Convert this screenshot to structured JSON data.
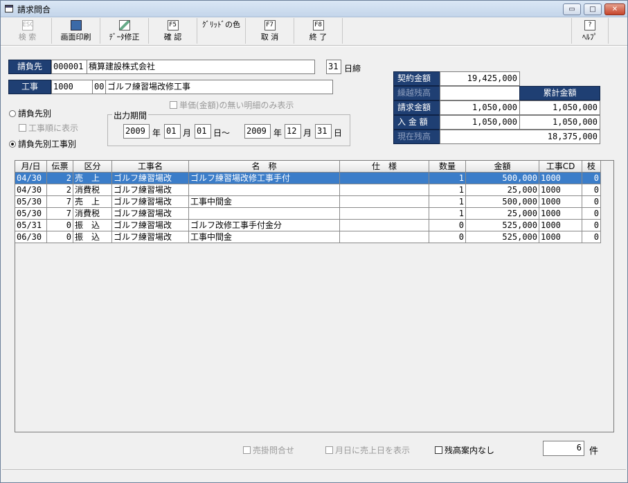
{
  "window": {
    "title": "請求問合"
  },
  "toolbar": {
    "search": {
      "key": "ESC",
      "label": "検 索"
    },
    "print": {
      "label": "画面印刷"
    },
    "edit": {
      "label": "ﾃﾞｰﾀ修正"
    },
    "confirm": {
      "key": "F5",
      "label": "確 認"
    },
    "gridcolor": {
      "label": "ｸﾞﾘｯﾄﾞの色"
    },
    "cancel": {
      "key": "F7",
      "label": "取 消"
    },
    "exit": {
      "key": "F8",
      "label": "終 了"
    },
    "help": {
      "key": "?",
      "label": "ﾍﾙﾌﾟ"
    }
  },
  "header": {
    "client_label": "請負先",
    "client_code": "000001",
    "client_name": "積算建設株式会社",
    "closing_day": "31",
    "closing_suffix": "日締",
    "project_label": "工事",
    "project_code": "1000",
    "project_branch": "00",
    "project_name": "ゴルフ練習場改修工事",
    "unit_price_option": "単価(金額)の無い明細のみ表示"
  },
  "options": {
    "by_client": "請負先別",
    "project_order": "工事順に表示",
    "by_client_project": "請負先別工事別"
  },
  "period": {
    "title": "出力期間",
    "from_year": "2009",
    "from_month": "01",
    "from_day": "01",
    "to_year": "2009",
    "to_month": "12",
    "to_day": "31",
    "year_unit": "年",
    "month_unit": "月",
    "day_unit": "日",
    "day_range": "日～"
  },
  "summary": {
    "contract_label": "契約金額",
    "contract_value": "19,425,000",
    "carryover_label": "繰越残高",
    "cumulative_label": "累計金額",
    "billing_label": "請求金額",
    "billing_value": "1,050,000",
    "billing_cumulative": "1,050,000",
    "payment_label": "入 金 額",
    "payment_value": "1,050,000",
    "payment_cumulative": "1,050,000",
    "balance_label": "現在残高",
    "balance_value": "18,375,000"
  },
  "table": {
    "columns": [
      "月/日",
      "伝票",
      "区分",
      "工事名",
      "名　称",
      "仕　様",
      "数量",
      "金額",
      "工事CD",
      "枝"
    ],
    "rows": [
      [
        "04/30",
        "2",
        "売　上",
        "ゴルフ練習場改",
        "ゴルフ練習場改修工事手付",
        "",
        "1",
        "500,000",
        "1000",
        "0"
      ],
      [
        "04/30",
        "2",
        "消費税",
        "ゴルフ練習場改",
        "",
        "",
        "1",
        "25,000",
        "1000",
        "0"
      ],
      [
        "05/30",
        "7",
        "売　上",
        "ゴルフ練習場改",
        "工事中間金",
        "",
        "1",
        "500,000",
        "1000",
        "0"
      ],
      [
        "05/30",
        "7",
        "消費税",
        "ゴルフ練習場改",
        "",
        "",
        "1",
        "25,000",
        "1000",
        "0"
      ],
      [
        "05/31",
        "0",
        "振　込",
        "ゴルフ練習場改",
        "ゴルフ改修工事手付金分",
        "",
        "0",
        "525,000",
        "1000",
        "0"
      ],
      [
        "06/30",
        "0",
        "振　込",
        "ゴルフ練習場改",
        "工事中間金",
        "",
        "0",
        "525,000",
        "1000",
        "0"
      ]
    ]
  },
  "footer": {
    "credit_inquiry": "売掛問合せ",
    "show_sales_date": "月日に売上日を表示",
    "no_balance_notice": "残高案内なし",
    "count": "6",
    "count_unit": "件"
  }
}
